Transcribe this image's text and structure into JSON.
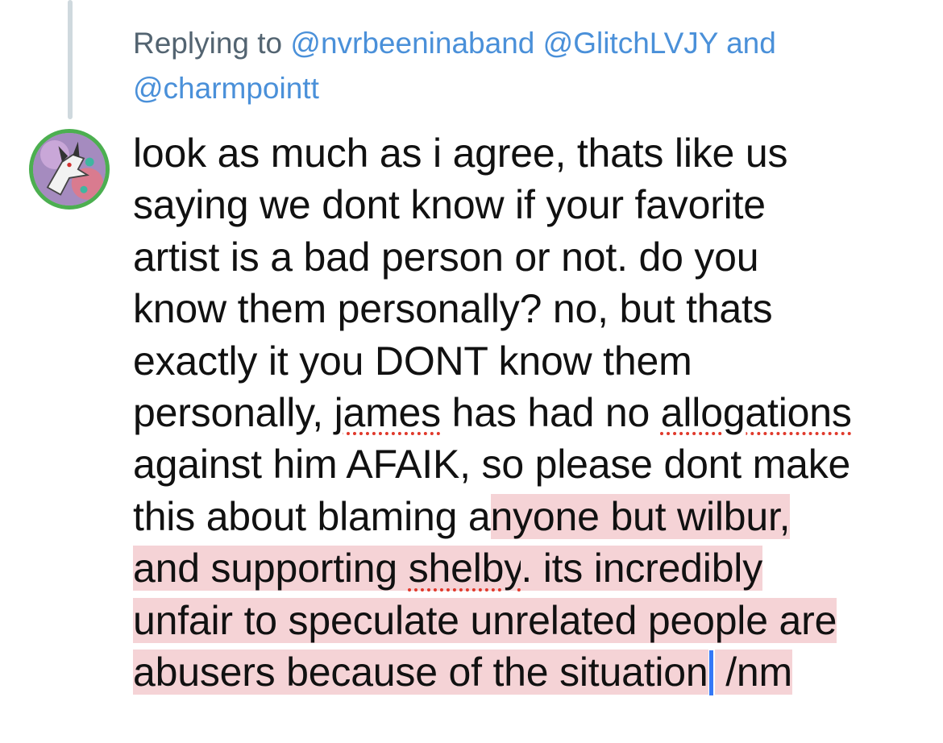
{
  "reply_context": {
    "prefix": "Replying to",
    "handle_1": "@nvrbeeninaband",
    "handle_2": "@GlitchLVJY",
    "conjunction": "and",
    "handle_3": "@charmpointt"
  },
  "avatar": {
    "icon": "dragon-avatar",
    "ring_color": "#4caf50"
  },
  "tweet": {
    "line_1": "look as much as i agree, thats like us",
    "line_2": "saying we dont know if your favorite",
    "line_3": "artist is a bad person or not. do you",
    "line_4": "know them personally? no, but thats",
    "line_5": "exactly it you DONT know them",
    "line_6_a": "personally, ",
    "line_6_b": "james",
    "line_6_c": " has had no ",
    "line_6_d": "allogations",
    "line_7": "against him AFAIK, so please dont make",
    "line_8_a": "this about blaming a",
    "line_8_b": "nyone but wilbur,",
    "line_9_a": "and supporting ",
    "line_9_b": "shelby",
    "line_9_c": ". its incredibly",
    "line_10": "unfair to speculate unrelated people are",
    "line_11_a": "abusers because of the situation",
    "line_11_b": " /nm"
  },
  "colors": {
    "selection_highlight": "#f5d3d6",
    "spellcheck_underline": "#e0392b",
    "caret": "#3478f6",
    "handle_link": "#4a90d9",
    "muted_text": "#536471"
  }
}
